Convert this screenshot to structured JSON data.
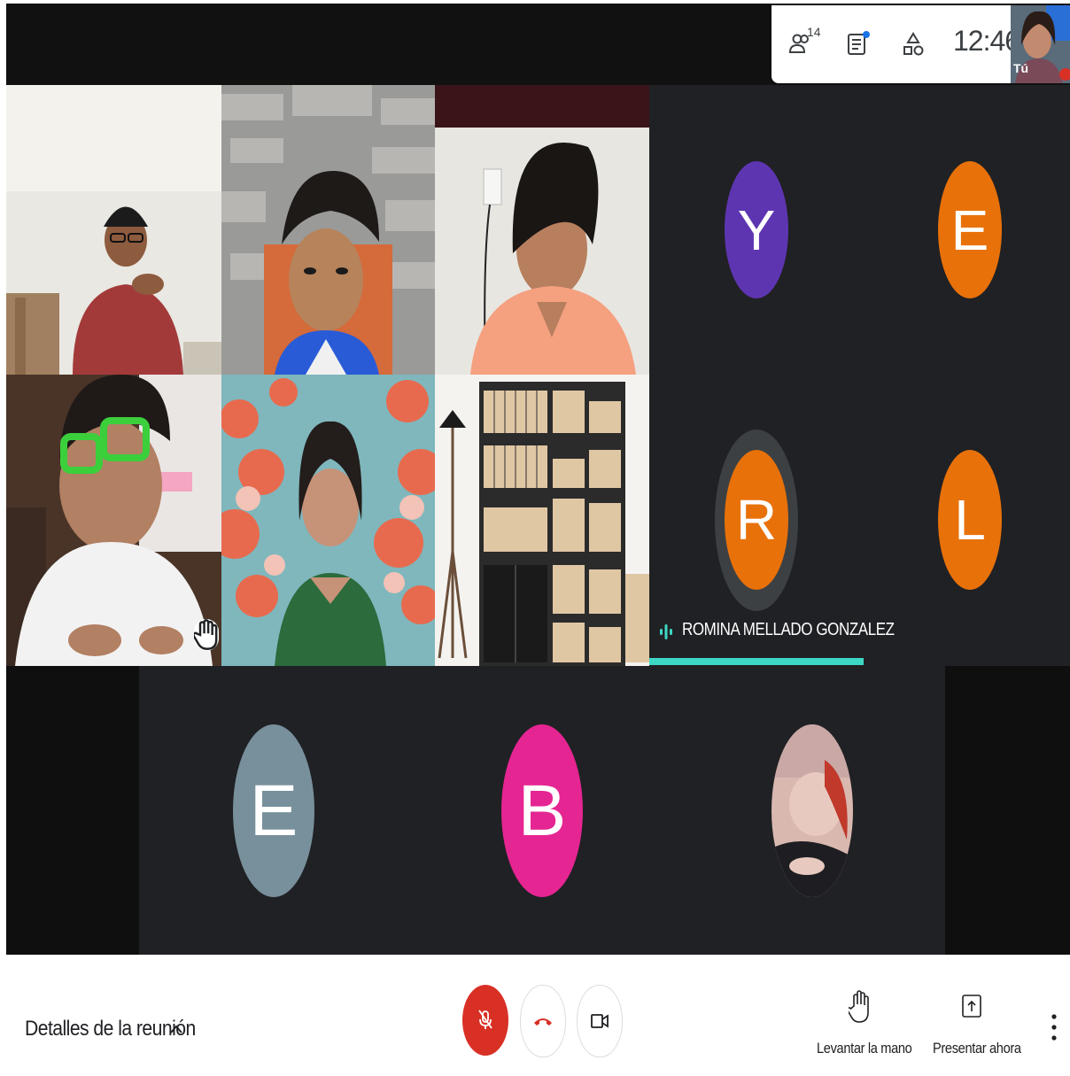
{
  "status_bar": {
    "participants_count": "14",
    "time": "12:46",
    "self_label": "Tú"
  },
  "participants": {
    "avatar_letters": [
      "Y",
      "E",
      "R",
      "L",
      "E",
      "B"
    ],
    "colors": {
      "Y": "#5e35b1",
      "E_orange": "#e8710a",
      "R": "#e8710a",
      "L": "#e8710a",
      "E_grey": "#78909c",
      "B": "#e52592"
    },
    "active_speaker": "ROMINA MELLADO GONZALEZ"
  },
  "controls": {
    "meeting_details": "Detalles de la reunión",
    "raise_hand": "Levantar la mano",
    "present_now": "Presentar ahora"
  },
  "icons": {
    "participants": "people-icon",
    "chat": "chat-icon",
    "activities": "shapes-icon",
    "mic": "mic-off-icon",
    "hangup": "call-end-icon",
    "camera": "camera-icon",
    "raise_hand": "hand-icon",
    "present": "present-icon",
    "more": "more-vert-icon"
  }
}
